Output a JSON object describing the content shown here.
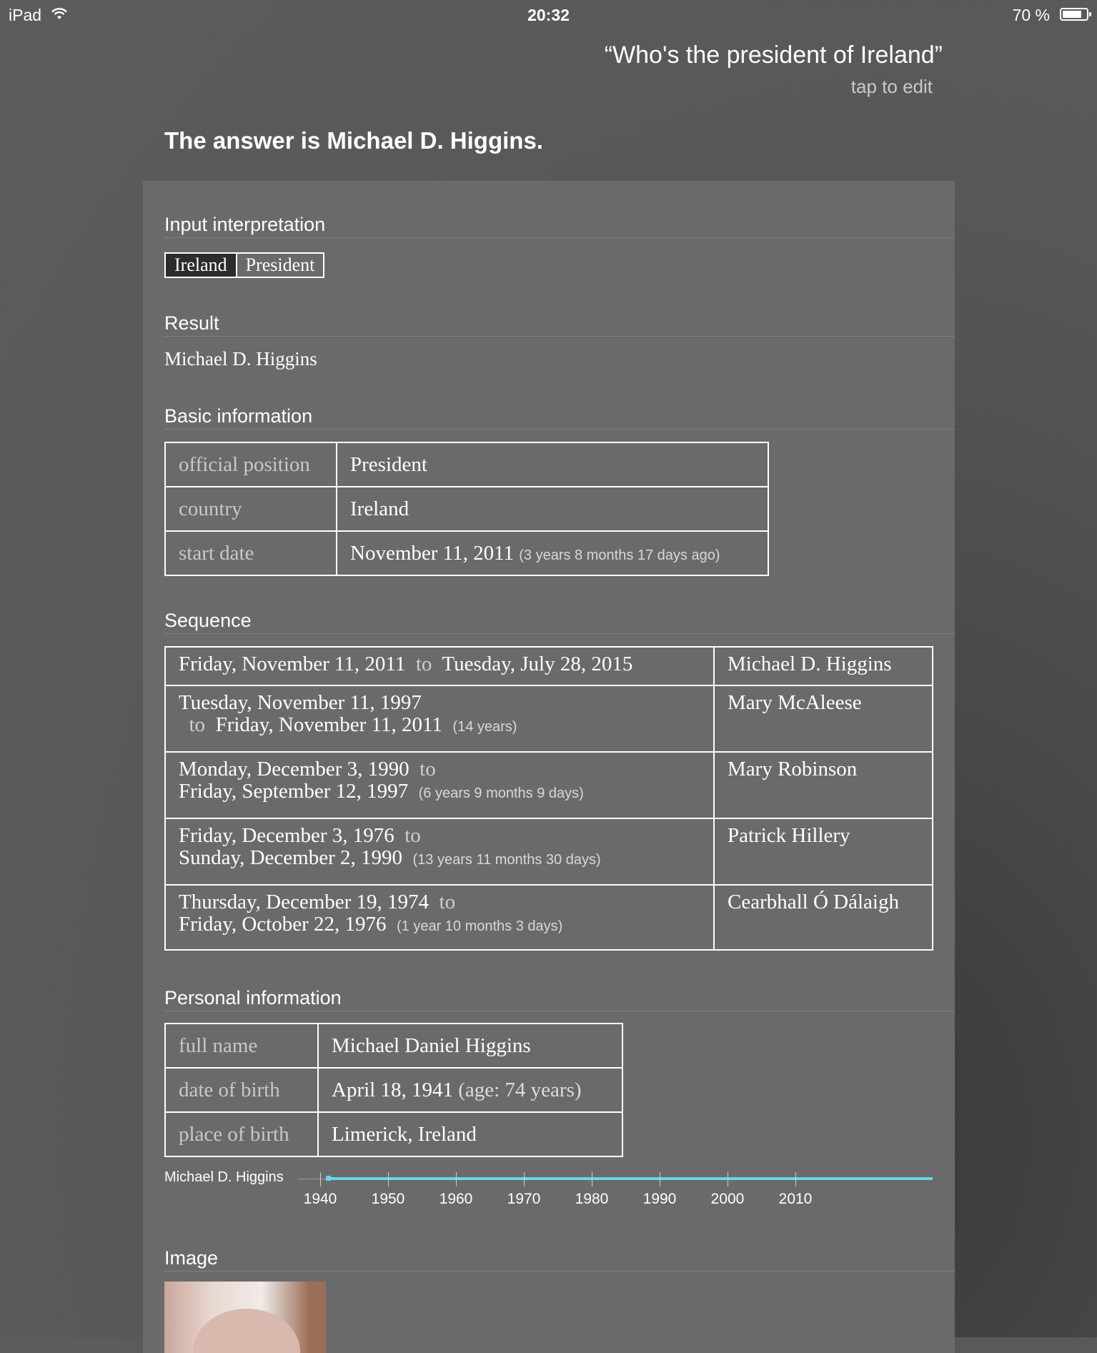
{
  "status": {
    "carrier": "iPad",
    "time": "20:32",
    "battery": "70 %"
  },
  "query": {
    "text": "“Who's the president of Ireland”",
    "edit": "tap to edit"
  },
  "answer": "The answer is Michael D. Higgins.",
  "input_interpretation": {
    "title": "Input interpretation",
    "chips": [
      "Ireland",
      "President"
    ]
  },
  "result": {
    "title": "Result",
    "value": "Michael D. Higgins"
  },
  "basic": {
    "title": "Basic information",
    "rows": [
      {
        "label": "official position",
        "value": "President",
        "note": ""
      },
      {
        "label": "country",
        "value": "Ireland",
        "note": ""
      },
      {
        "label": "start date",
        "value": "November 11, 2011",
        "note": "(3 years 8 months 17 days ago)"
      }
    ]
  },
  "sequence": {
    "title": "Sequence",
    "rows": [
      {
        "line1": "Friday, November 11, 2011",
        "to1": "to",
        "line1b": "Tuesday, July 28, 2015",
        "line2": "",
        "to2": "",
        "note": "",
        "name": "Michael D. Higgins"
      },
      {
        "line1": "Tuesday, November 11, 1997",
        "to1": "",
        "line1b": "",
        "line2": "Friday, November 11, 2011",
        "to2": "to",
        "note": "(14 years)",
        "name": "Mary McAleese"
      },
      {
        "line1": "Monday, December 3, 1990",
        "to1": "to",
        "line1b": "",
        "line2": "Friday, September 12, 1997",
        "to2": "",
        "note": "(6 years 9 months 9 days)",
        "name": "Mary Robinson"
      },
      {
        "line1": "Friday, December 3, 1976",
        "to1": "to",
        "line1b": "",
        "line2": "Sunday, December 2, 1990",
        "to2": "",
        "note": "(13 years 11 months 30 days)",
        "name": "Patrick Hillery"
      },
      {
        "line1": "Thursday, December 19, 1974",
        "to1": "to",
        "line1b": "",
        "line2": "Friday, October 22, 1976",
        "to2": "",
        "note": "(1 year 10 months 3 days)",
        "name": "Cearbhall Ó Dálaigh"
      }
    ]
  },
  "personal": {
    "title": "Personal information",
    "rows": [
      {
        "label": "full name",
        "value": "Michael Daniel Higgins",
        "note": ""
      },
      {
        "label": "date of birth",
        "value": "April 18, 1941",
        "note": "(age: 74 years)"
      },
      {
        "label": "place of birth",
        "value": "Limerick, Ireland",
        "note": ""
      }
    ]
  },
  "timeline": {
    "name": "Michael D. Higgins",
    "ticks": [
      "1940",
      "1950",
      "1960",
      "1970",
      "1980",
      "1990",
      "2000",
      "2010"
    ],
    "start_year": 1941,
    "accent": "#66d6e8"
  },
  "image": {
    "title": "Image"
  },
  "colors": {
    "panel": "#6a6a6c",
    "accent": "#66d6e8"
  }
}
